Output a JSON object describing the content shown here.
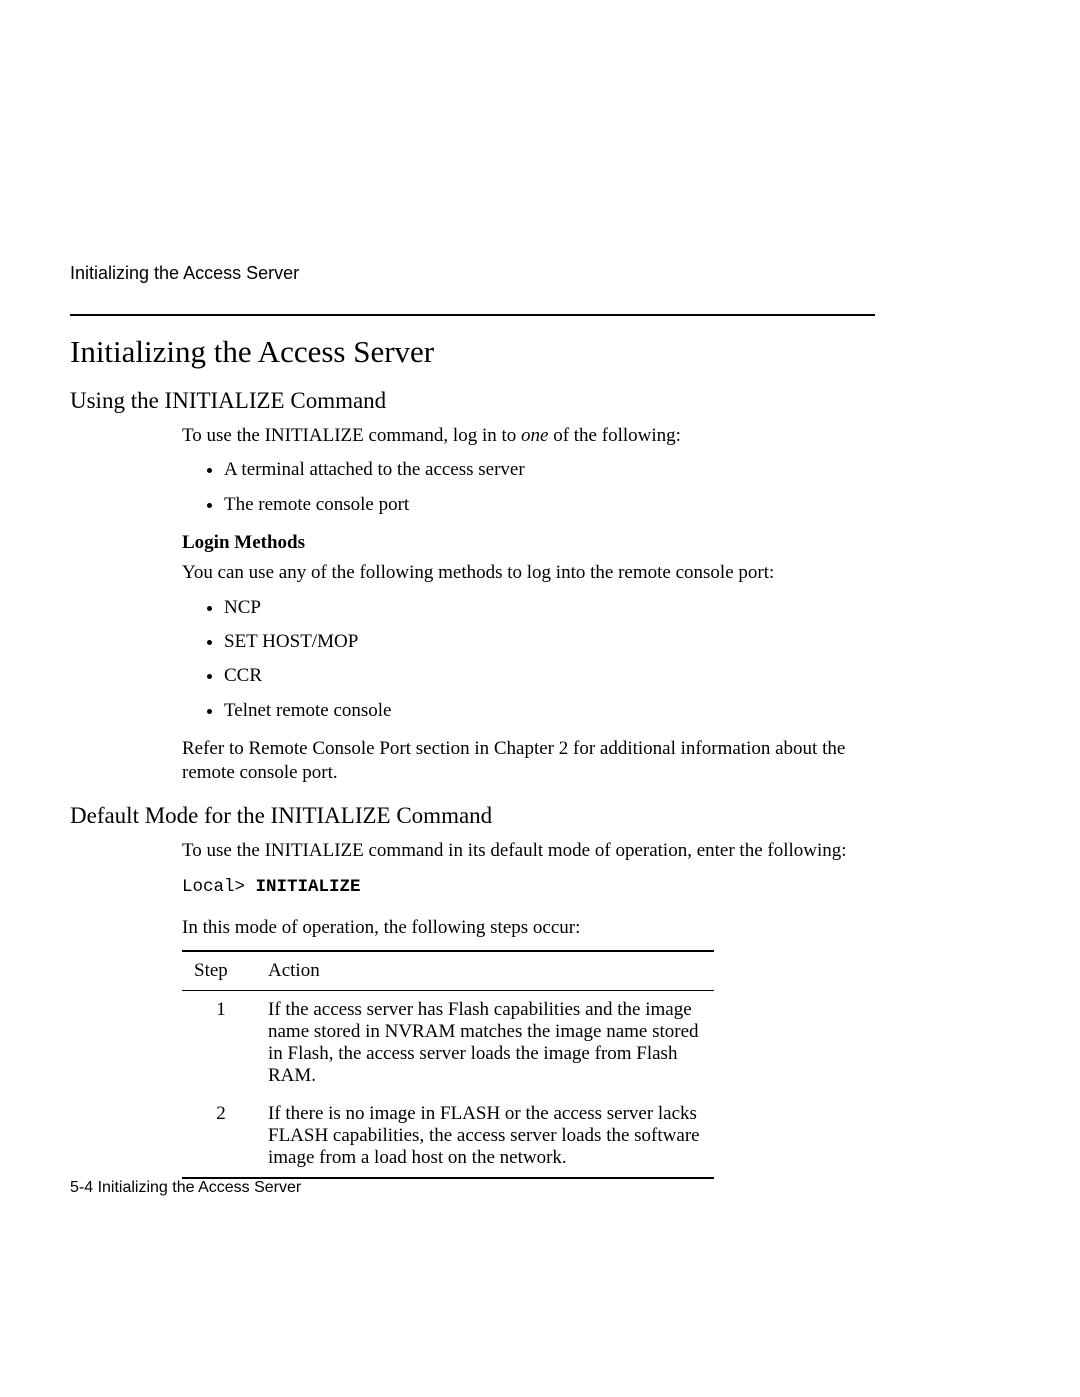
{
  "header": {
    "running_head": "Initializing the Access Server"
  },
  "section": {
    "title": "Initializing the Access Server"
  },
  "sub1": {
    "heading": "Using the INITIALIZE Command",
    "intro_a": "To use the INITIALIZE command, log in to ",
    "intro_em": "one",
    "intro_b": " of the following:",
    "bullets_a": [
      "A terminal attached to the access server",
      "The remote console port"
    ],
    "login_label": "Login Methods",
    "login_text": "You can use any of the following methods to log into the remote console port:",
    "bullets_b": [
      "NCP",
      "SET HOST/MOP",
      "CCR",
      "Telnet remote console"
    ],
    "ref_text": "Refer to Remote Console Port section in Chapter 2 for additional information about the remote console port."
  },
  "sub2": {
    "heading": "Default Mode for the INITIALIZE Command",
    "intro": "To use the INITIALIZE command in its default mode of operation, enter the following:",
    "prompt": "Local> ",
    "command": "INITIALIZE",
    "after_cmd": "In this mode of operation, the following steps occur:",
    "table": {
      "col1": "Step",
      "col2": "Action",
      "rows": [
        {
          "step": "1",
          "action": "If the access server has Flash capabilities and the image name stored in NVRAM matches the image name stored in Flash, the access server loads the image from Flash RAM."
        },
        {
          "step": "2",
          "action": "If there is no image in FLASH or the access server lacks FLASH capabilities, the access server loads the software image from a load host on the network."
        }
      ]
    }
  },
  "footer": {
    "page_label": "5-4  Initializing the Access Server"
  }
}
